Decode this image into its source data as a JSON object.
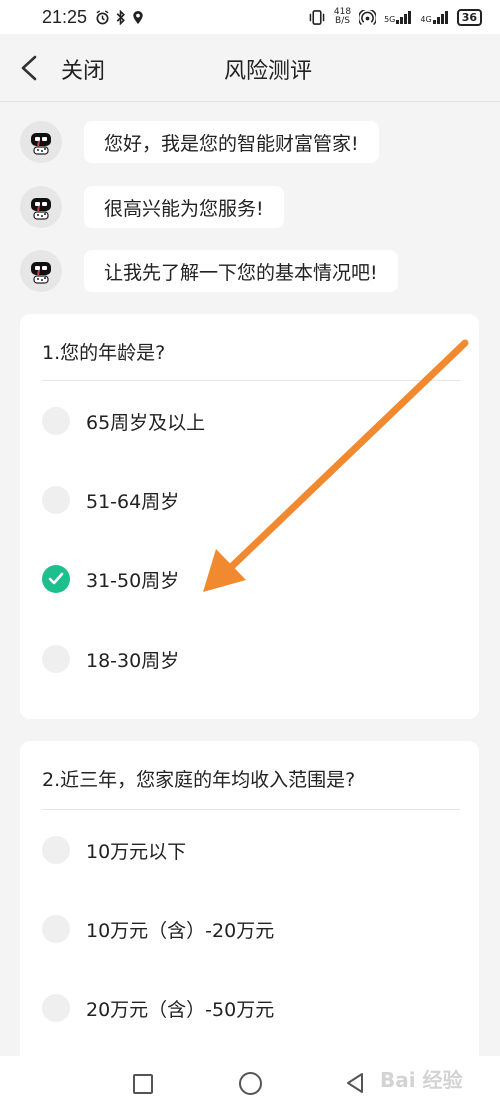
{
  "status_bar": {
    "time": "21:25",
    "net_speed_value": "418",
    "net_speed_unit": "B/S",
    "signal_1": "5G",
    "signal_2": "4G",
    "battery": "36"
  },
  "header": {
    "close_label": "关闭",
    "title": "风险测评"
  },
  "chat": [
    {
      "text": "您好，我是您的智能财富管家!"
    },
    {
      "text": "很高兴能为您服务!"
    },
    {
      "text": "让我先了解一下您的基本情况吧!"
    }
  ],
  "questions": [
    {
      "text": "1.您的年龄是?",
      "options": [
        {
          "label": "65周岁及以上",
          "selected": false
        },
        {
          "label": "51-64周岁",
          "selected": false
        },
        {
          "label": "31-50周岁",
          "selected": true
        },
        {
          "label": "18-30周岁",
          "selected": false
        }
      ]
    },
    {
      "text": "2.近三年，您家庭的年均收入范围是?",
      "options": [
        {
          "label": "10万元以下",
          "selected": false
        },
        {
          "label": "10万元（含）-20万元",
          "selected": false
        },
        {
          "label": "20万元（含）-50万元",
          "selected": false
        }
      ]
    }
  ],
  "accent_color": "#1dbf8c",
  "annotation_arrow_color": "#f0892f",
  "watermark": "Bai 经验"
}
